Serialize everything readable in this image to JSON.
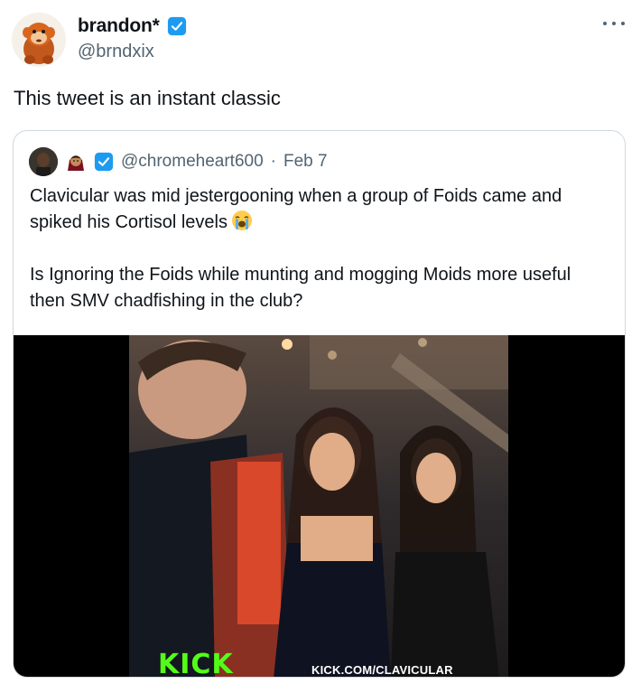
{
  "author": {
    "display_name": "brandon*",
    "handle": "@brndxix",
    "avatar_icon": "monkey-avatar-icon",
    "verified_color": "#1d9bf0"
  },
  "tweet": {
    "text": "This tweet is an instant classic"
  },
  "quote": {
    "handle": "@chromeheart600",
    "separator": "·",
    "date": "Feb 7",
    "paragraph1": "Clavicular was mid jestergooning when a group of Foids came and spiked his Cortisol levels",
    "paragraph2": "Is Ignoring the Foids while munting and mogging Moids more useful then SMV chadfishing in the club?",
    "emoji_icon": "loudly-crying-face-icon"
  },
  "media": {
    "logo_text": "KICK",
    "url_text": "KICK.COM/CLAVICULAR",
    "logo_color": "#53fc18"
  }
}
